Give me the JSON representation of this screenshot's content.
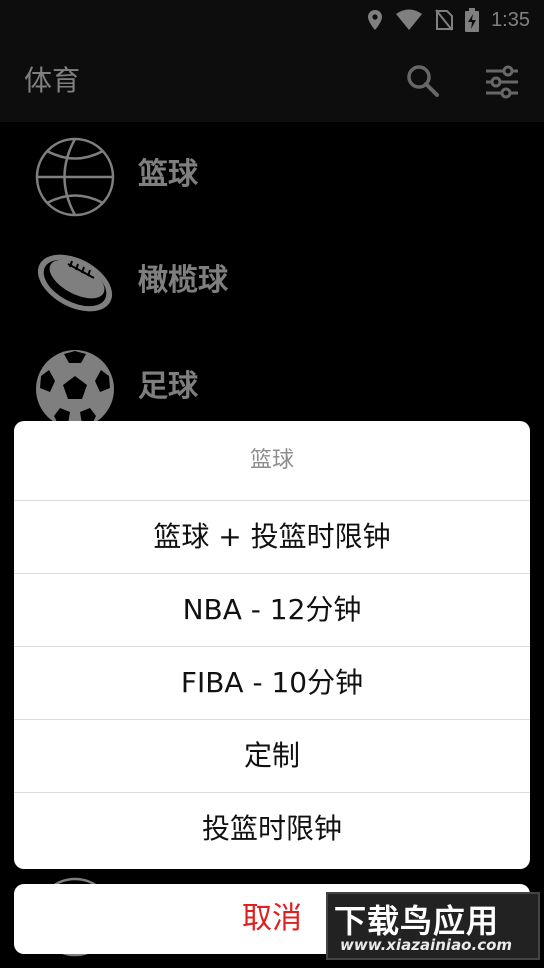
{
  "status_bar": {
    "time": "1:35"
  },
  "app_bar": {
    "title": "体育"
  },
  "sports": [
    {
      "label": "篮球",
      "icon": "basketball-icon"
    },
    {
      "label": "橄榄球",
      "icon": "rugby-ball-icon"
    },
    {
      "label": "足球",
      "icon": "soccer-ball-icon"
    }
  ],
  "sheet": {
    "title": "篮球",
    "options": [
      "篮球 + 投篮时限钟",
      "NBA - 12分钟",
      "FIBA - 10分钟",
      "定制",
      "投篮时限钟"
    ],
    "cancel": "取消"
  },
  "watermark": {
    "main": "下载鸟应用",
    "sub": "www.xiazainiao.com"
  },
  "colors": {
    "cancel": "#e02020",
    "title_gray": "#8e8e8e",
    "app_bar": "#1a1a1a"
  }
}
